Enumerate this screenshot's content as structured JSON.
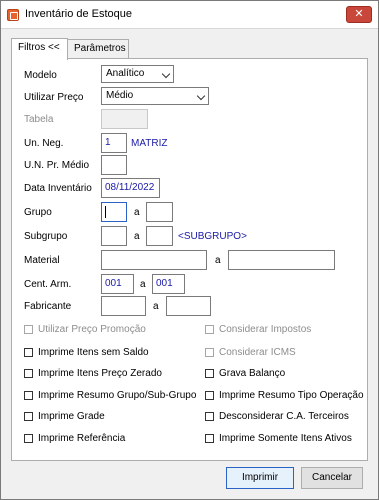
{
  "window": {
    "title": "Inventário de Estoque",
    "close_glyph": "✕"
  },
  "tabs": [
    {
      "label": "Filtros <<"
    },
    {
      "label": "Parâmetros"
    }
  ],
  "form": {
    "modelo": {
      "label": "Modelo",
      "value": "Analítico"
    },
    "utilizar_preco": {
      "label": "Utilizar Preço",
      "value": "Médio"
    },
    "tabela": {
      "label": "Tabela",
      "value": ""
    },
    "un_neg": {
      "label": "Un. Neg.",
      "value": "1",
      "description": "MATRIZ"
    },
    "un_pr_medio": {
      "label": "U.N. Pr. Médio",
      "value": ""
    },
    "data_inventario": {
      "label": "Data Inventário",
      "value": "08/11/2022"
    },
    "grupo": {
      "label": "Grupo",
      "from": "",
      "sep": "a",
      "to": ""
    },
    "subgrupo": {
      "label": "Subgrupo",
      "from": "",
      "sep": "a",
      "to": "",
      "description": "<SUBGRUPO>"
    },
    "material": {
      "label": "Material",
      "from": "",
      "sep": "a",
      "to": ""
    },
    "cent_arm": {
      "label": "Cent. Arm.",
      "from": "001",
      "sep": "a",
      "to": "001"
    },
    "fabricante": {
      "label": "Fabricante",
      "from": "",
      "sep": "a",
      "to": ""
    }
  },
  "checkboxes_left": [
    {
      "label": "Utilizar Preço Promoção",
      "checked": false,
      "enabled": false
    },
    {
      "label": "Imprime Itens sem Saldo",
      "checked": false,
      "enabled": true
    },
    {
      "label": "Imprime Itens Preço Zerado",
      "checked": false,
      "enabled": true
    },
    {
      "label": "Imprime Resumo Grupo/Sub-Grupo",
      "checked": false,
      "enabled": true
    },
    {
      "label": "Imprime Grade",
      "checked": false,
      "enabled": true
    },
    {
      "label": "Imprime Referência",
      "checked": false,
      "enabled": true
    }
  ],
  "checkboxes_right": [
    {
      "label": "Considerar Impostos",
      "checked": false,
      "enabled": false
    },
    {
      "label": "Considerar ICMS",
      "checked": false,
      "enabled": false
    },
    {
      "label": "Grava Balanço",
      "checked": false,
      "enabled": true
    },
    {
      "label": "Imprime Resumo Tipo Operação",
      "checked": false,
      "enabled": true
    },
    {
      "label": "Desconsiderar C.A. Terceiros",
      "checked": false,
      "enabled": true
    },
    {
      "label": "Imprime Somente Itens Ativos",
      "checked": false,
      "enabled": true
    }
  ],
  "buttons": {
    "print": "Imprimir",
    "cancel": "Cancelar"
  }
}
